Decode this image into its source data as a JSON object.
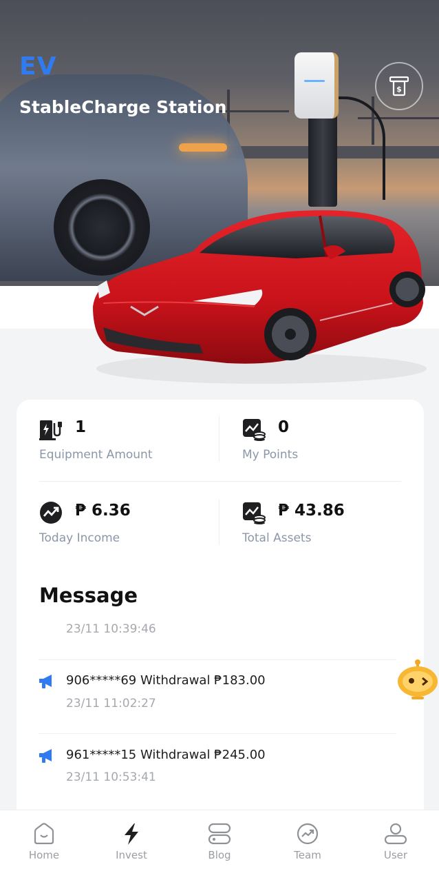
{
  "header": {
    "logo": "EV",
    "title": "StableCharge Station"
  },
  "stats": {
    "equipment": {
      "value": "1",
      "label": "Equipment Amount"
    },
    "points": {
      "value": "0",
      "label": "My Points"
    },
    "today_income": {
      "value": "₱ 6.36",
      "label": "Today Income"
    },
    "total_assets": {
      "value": "₱ 43.86",
      "label": "Total Assets"
    }
  },
  "messages": {
    "title": "Message",
    "items": [
      {
        "text": "",
        "time": "23/11 10:39:46"
      },
      {
        "text": "906*****69 Withdrawal ₱183.00",
        "time": "23/11 11:02:27"
      },
      {
        "text": "961*****15 Withdrawal ₱245.00",
        "time": "23/11 10:53:41"
      }
    ]
  },
  "nav": {
    "items": [
      {
        "label": "Home",
        "icon": "home-icon"
      },
      {
        "label": "Invest",
        "icon": "lightning-icon"
      },
      {
        "label": "Blog",
        "icon": "blog-icon"
      },
      {
        "label": "Team",
        "icon": "team-icon"
      },
      {
        "label": "User",
        "icon": "user-icon"
      }
    ]
  },
  "colors": {
    "accent": "#2f7bef",
    "label": "#8a97a8",
    "car": "#d0161c"
  }
}
